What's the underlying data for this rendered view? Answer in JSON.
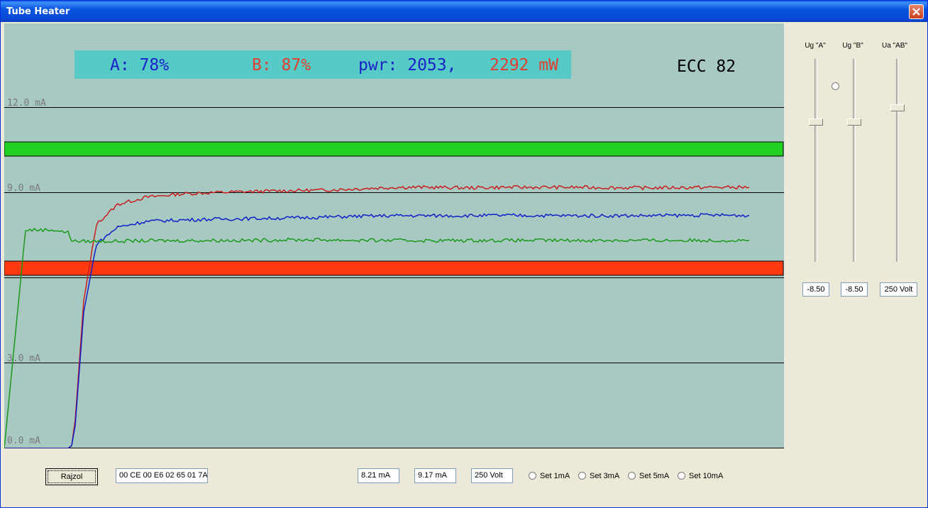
{
  "window": {
    "title": "Tube Heater"
  },
  "display": {
    "a_text": "A: 78%",
    "b_text": "B: 87%",
    "pwr_text": "pwr: 2053,",
    "pwr_b_text": "2292 mW",
    "tube_type": "ECC 82",
    "colors": {
      "a": "#1a22c8",
      "b": "#e04030",
      "info_bg": "#55cac6",
      "plot_bg": "#a8c8c2",
      "green_band": "#22d022",
      "red_band": "#ff3a10"
    }
  },
  "y_labels": [
    "12.0 mA",
    "9.0 mA",
    "3.0 mA",
    "0.0 mA"
  ],
  "sliders": [
    {
      "label": "Ug \"A\"",
      "value": "-8.50",
      "level": 0.31
    },
    {
      "label": "Ug \"B\"",
      "value": "-8.50",
      "level": 0.31
    },
    {
      "label": "Ua \"AB\"",
      "value": "250 Volt",
      "level": 0.24
    }
  ],
  "bottom": {
    "draw_button": "Rajzol",
    "hex_field": "00 CE 00 E6 02 65 01 7A",
    "current_a": "8.21 mA",
    "current_b": "9.17 mA",
    "voltage": "250 Volt",
    "radios": [
      "Set 1mA",
      "Set 3mA",
      "Set 5mA",
      "Set 10mA"
    ]
  },
  "chart_data": {
    "type": "line",
    "ylabel": "",
    "ylim": [
      0,
      12
    ],
    "gridlines": [
      12,
      9,
      6,
      3,
      0
    ],
    "bands": [
      {
        "color": "green",
        "y_range": [
          10.3,
          10.8
        ]
      },
      {
        "color": "red",
        "y_range": [
          6.1,
          6.6
        ]
      }
    ],
    "series": [
      {
        "color": "red",
        "values": [
          0,
          0,
          0,
          0,
          0.1,
          1.0,
          5.2,
          7.9,
          8.6,
          8.85,
          8.97,
          9.02,
          9.05,
          9.08,
          9.1,
          9.15,
          9.2,
          9.2,
          9.18,
          9.2,
          9.2,
          9.18,
          9.2,
          9.2
        ]
      },
      {
        "color": "blue",
        "values": [
          0,
          0,
          0,
          0,
          0.1,
          0.8,
          4.8,
          7.2,
          7.8,
          8.0,
          8.05,
          8.08,
          8.1,
          8.12,
          8.15,
          8.18,
          8.2,
          8.2,
          8.2,
          8.21,
          8.2,
          8.2,
          8.22,
          8.21
        ]
      },
      {
        "color": "green",
        "values": [
          0,
          7.7,
          7.7,
          7.6,
          7.35,
          7.3,
          7.3,
          7.3,
          7.3,
          7.32,
          7.32,
          7.33,
          7.33,
          7.35,
          7.35,
          7.33,
          7.33,
          7.32,
          7.33,
          7.33,
          7.33,
          7.33,
          7.33,
          7.33
        ]
      }
    ]
  }
}
